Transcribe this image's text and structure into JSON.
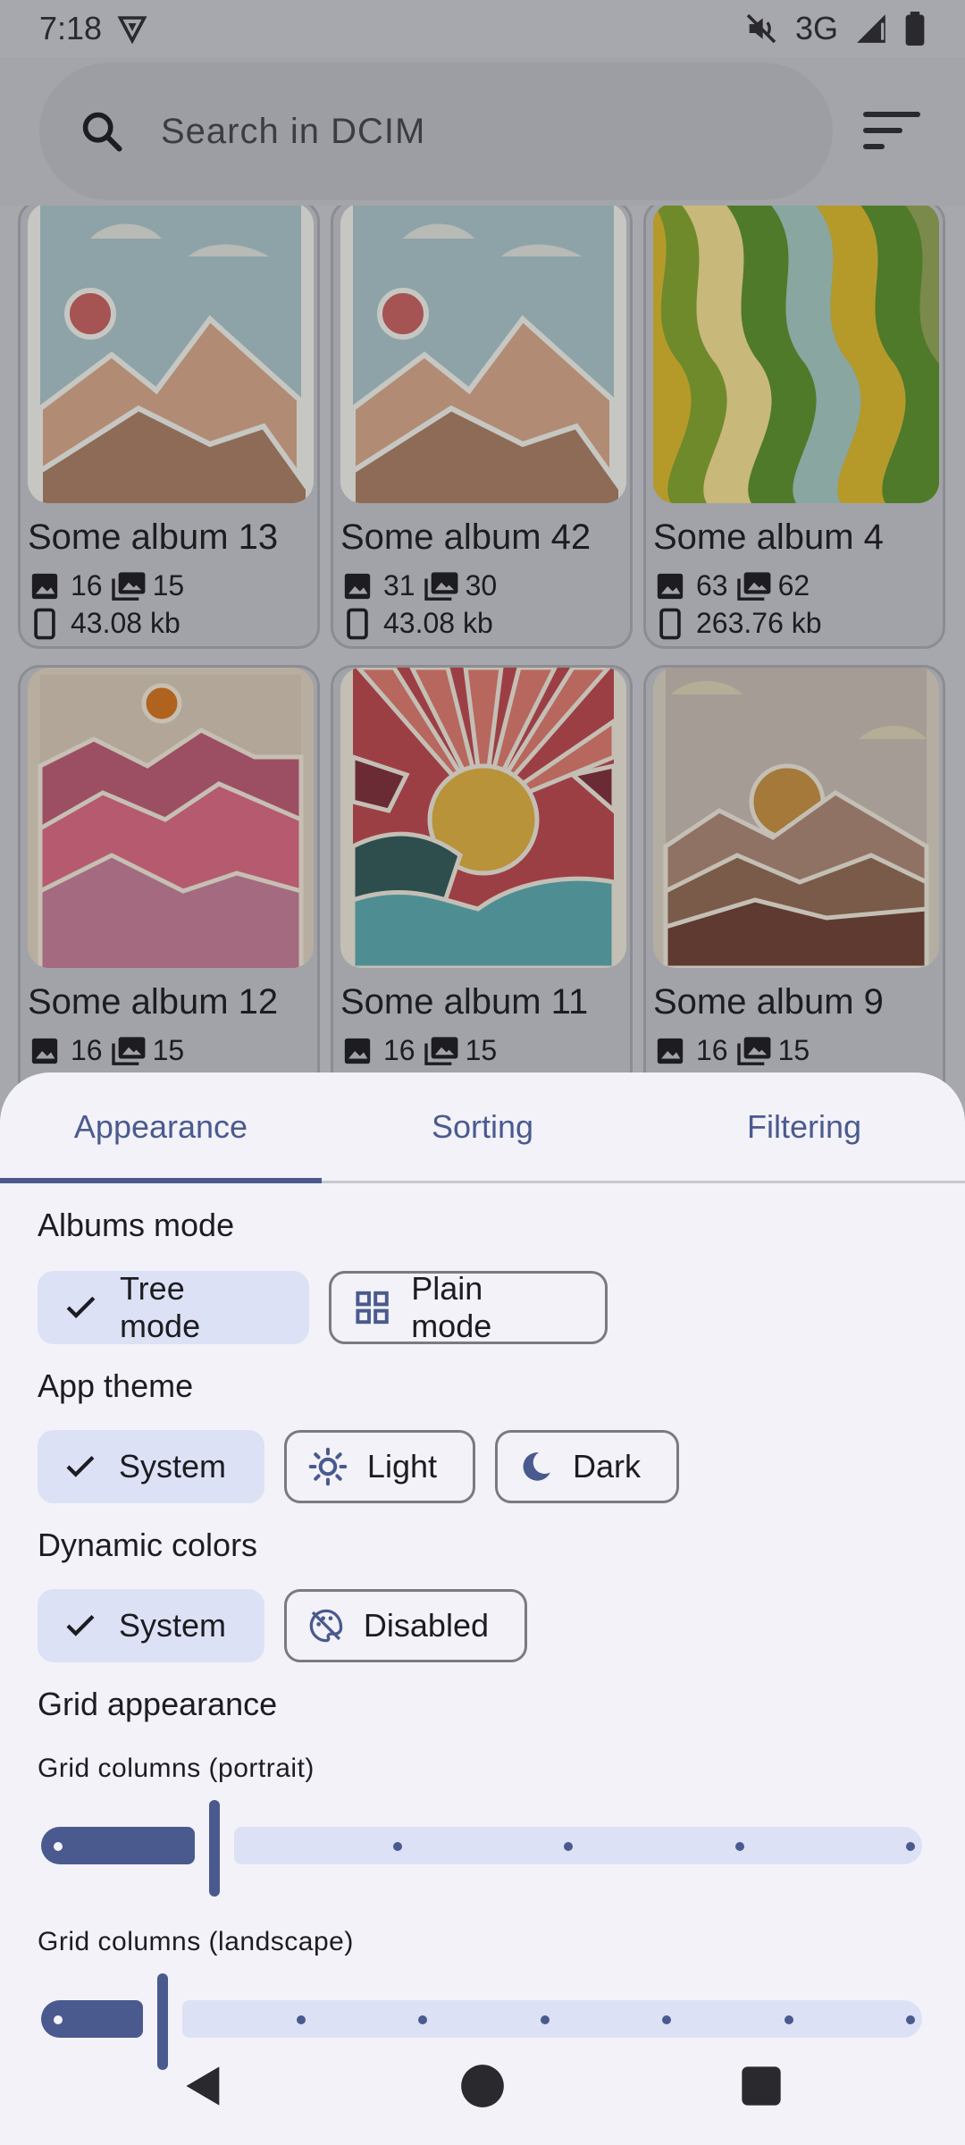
{
  "status_bar": {
    "time": "7:18",
    "network": "3G"
  },
  "search": {
    "placeholder": "Search in DCIM"
  },
  "albums": [
    {
      "title": "Some album 13",
      "images": "16",
      "media": "15",
      "size": "43.08 kb",
      "art": "sun-mountains"
    },
    {
      "title": "Some album 42",
      "images": "31",
      "media": "30",
      "size": "43.08 kb",
      "art": "sun-mountains"
    },
    {
      "title": "Some album 4",
      "images": "63",
      "media": "62",
      "size": "263.76 kb",
      "art": "waves"
    },
    {
      "title": "Some album 12",
      "images": "16",
      "media": "15",
      "size": "",
      "art": "pink-mountains"
    },
    {
      "title": "Some album 11",
      "images": "16",
      "media": "15",
      "size": "",
      "art": "sunrays"
    },
    {
      "title": "Some album 9",
      "images": "16",
      "media": "15",
      "size": "",
      "art": "desert-hills"
    }
  ],
  "tabs": [
    {
      "label": "Appearance",
      "active": true
    },
    {
      "label": "Sorting",
      "active": false
    },
    {
      "label": "Filtering",
      "active": false
    }
  ],
  "albums_mode": {
    "title": "Albums mode",
    "options": [
      {
        "label": "Tree mode",
        "selected": true,
        "icon": "check-icon"
      },
      {
        "label": "Plain mode",
        "selected": false,
        "icon": "grid-icon"
      }
    ]
  },
  "app_theme": {
    "title": "App theme",
    "options": [
      {
        "label": "System",
        "selected": true,
        "icon": "check-icon"
      },
      {
        "label": "Light",
        "selected": false,
        "icon": "sun-icon"
      },
      {
        "label": "Dark",
        "selected": false,
        "icon": "moon-icon"
      }
    ]
  },
  "dynamic_colors": {
    "title": "Dynamic colors",
    "options": [
      {
        "label": "System",
        "selected": true,
        "icon": "check-icon"
      },
      {
        "label": "Disabled",
        "selected": false,
        "icon": "palette-off-icon"
      }
    ]
  },
  "grid_appearance": {
    "title": "Grid appearance",
    "portrait": {
      "label": "Grid columns (portrait)",
      "value": 2,
      "min": 1,
      "max": 6
    },
    "landscape": {
      "label": "Grid columns (landscape)",
      "value": 2,
      "min": 1,
      "max": 8
    }
  },
  "colors": {
    "accent": "#4a5a8e",
    "accent_container": "#dde1f5",
    "sheet_bg": "#f2f2f8"
  }
}
